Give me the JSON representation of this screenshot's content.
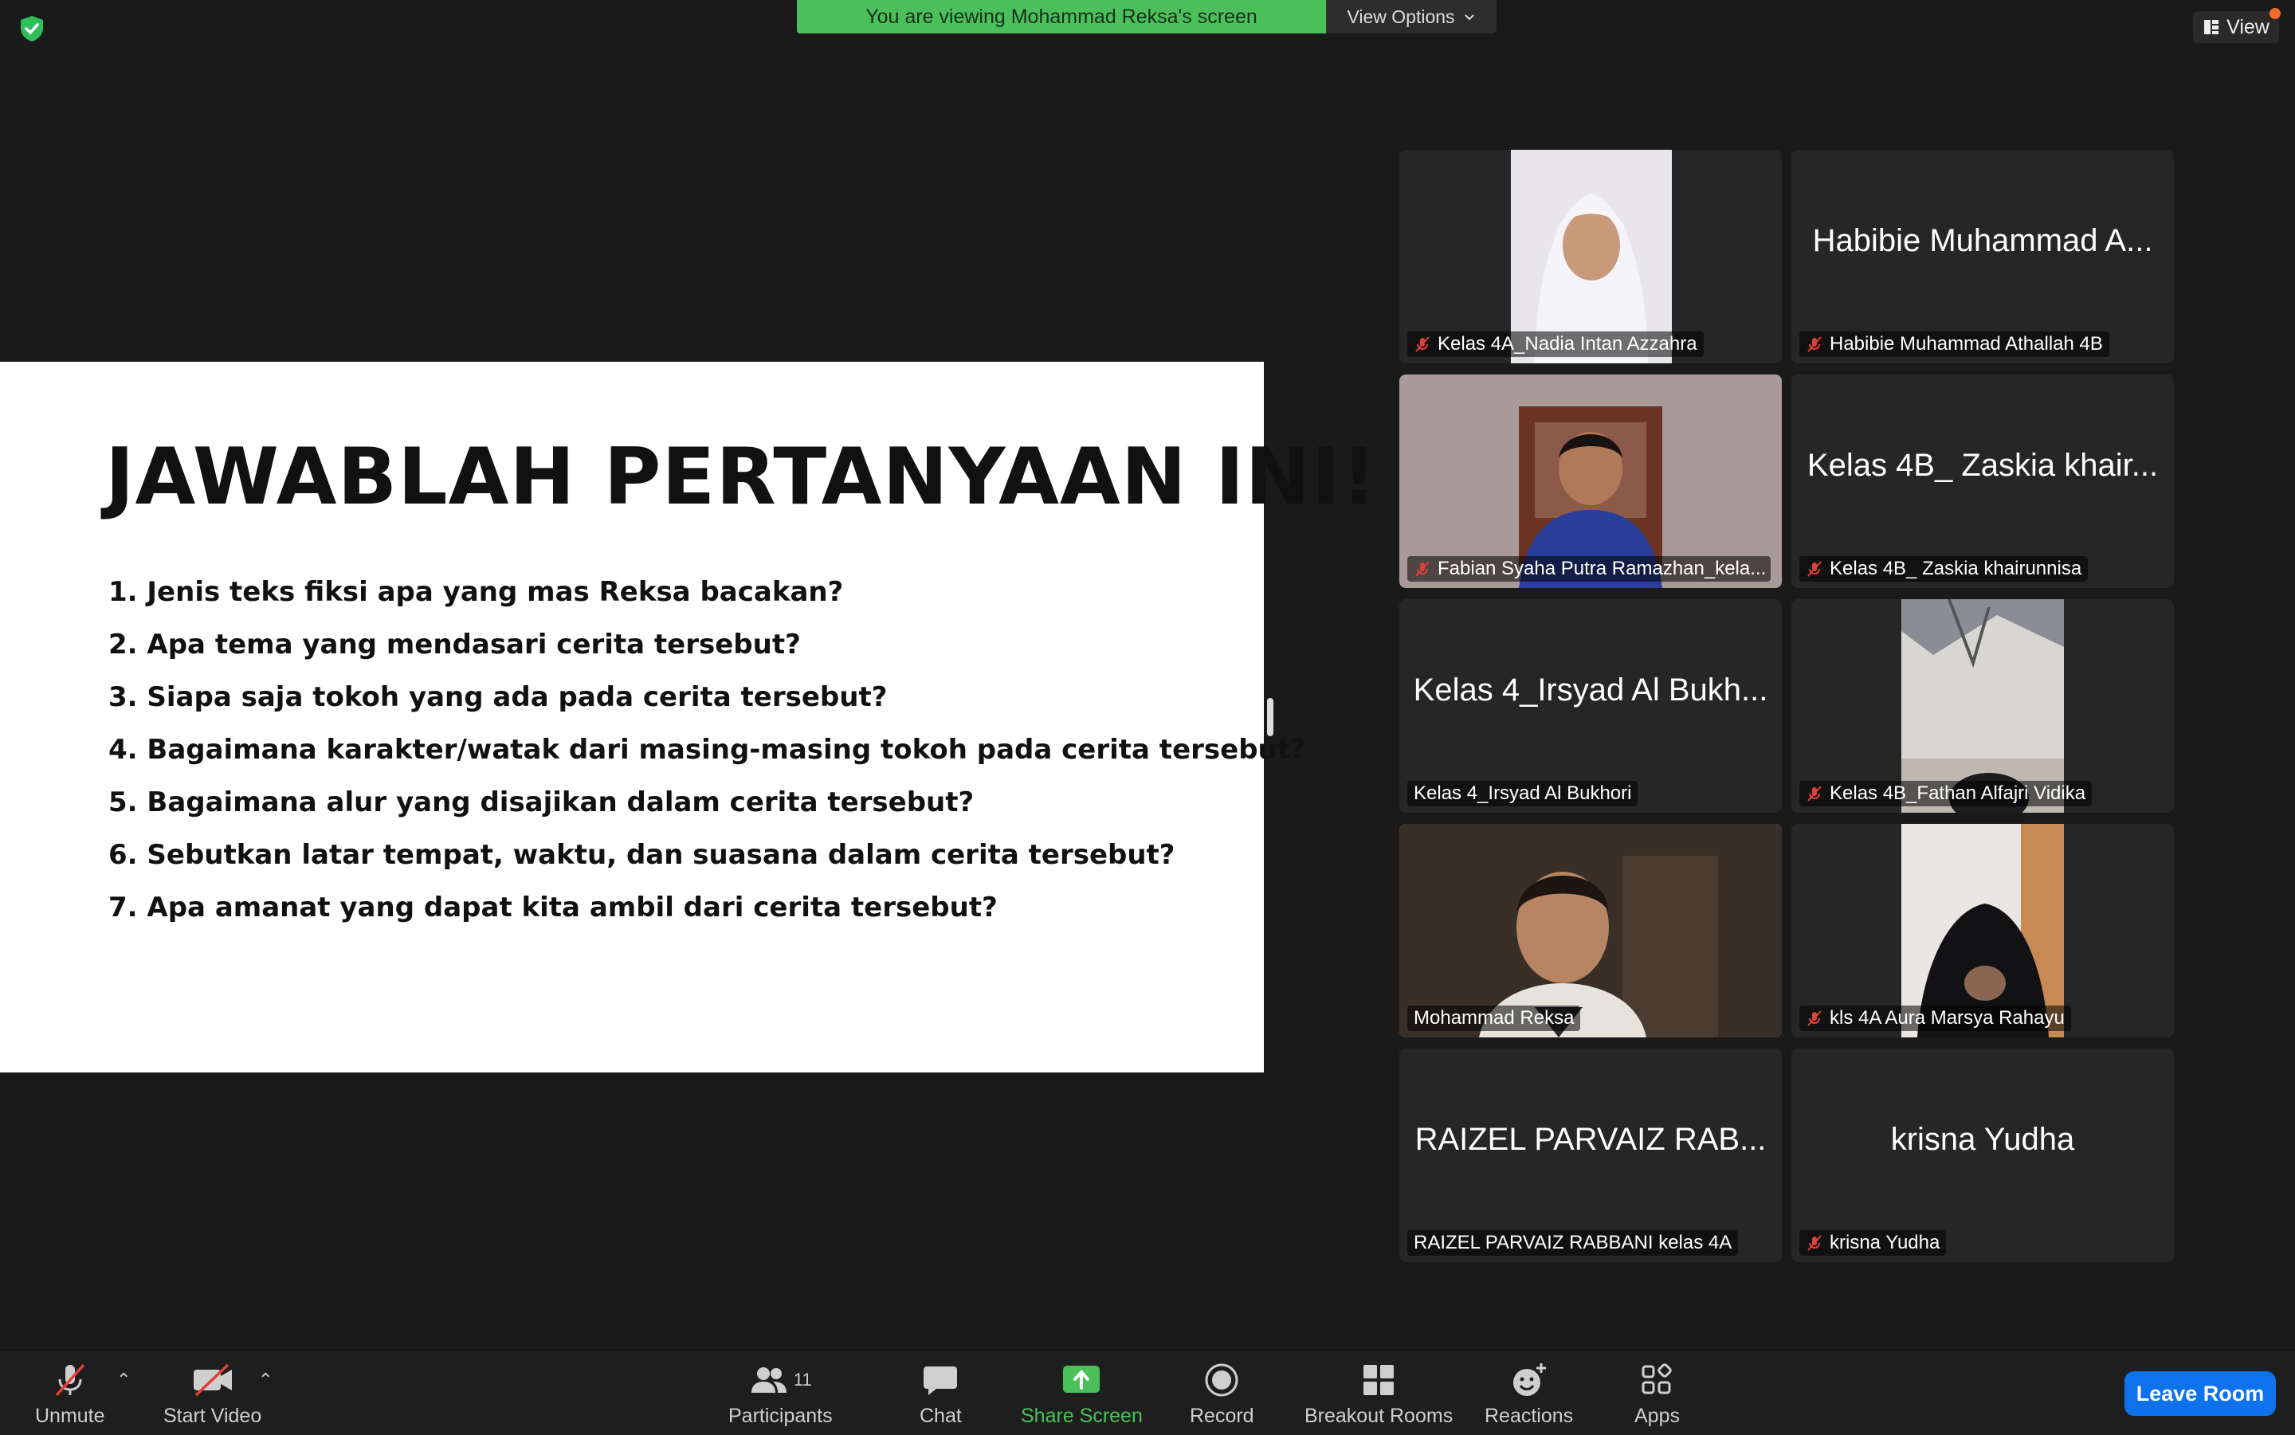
{
  "banner": {
    "message": "You are viewing Mohammad Reksa's screen",
    "view_options": "View Options"
  },
  "top_right": {
    "view_label": "View"
  },
  "slide": {
    "title": "JAWABLAH PERTANYAAN INI!",
    "questions": [
      "1. Jenis teks fiksi apa yang mas Reksa bacakan?",
      "2. Apa tema yang mendasari cerita tersebut?",
      "3. Siapa saja tokoh yang ada pada cerita tersebut?",
      "4. Bagaimana karakter/watak dari masing-masing tokoh pada cerita tersebut?",
      "5. Bagaimana alur yang disajikan dalam cerita tersebut?",
      "6. Sebutkan latar tempat, waktu, dan suasana dalam cerita tersebut?",
      "7. Apa amanat yang dapat kita ambil dari cerita tersebut?"
    ]
  },
  "participants": [
    {
      "label": "Kelas 4A_Nadia Intan Azzahra",
      "big_name": "",
      "muted": true,
      "video": "girl-hijab-white",
      "active": false
    },
    {
      "label": "Habibie Muhammad Athallah 4B",
      "big_name": "Habibie Muhammad A...",
      "muted": true,
      "video": "",
      "active": false
    },
    {
      "label": "Fabian Syaha Putra Ramazhan_kela...",
      "big_name": "",
      "muted": true,
      "video": "boy-chair",
      "active": false
    },
    {
      "label": "Kelas 4B_ Zaskia khairunnisa",
      "big_name": "Kelas 4B_ Zaskia khair...",
      "muted": true,
      "video": "",
      "active": false
    },
    {
      "label": "Kelas 4_Irsyad Al Bukhori",
      "big_name": "Kelas 4_Irsyad Al Bukh...",
      "muted": false,
      "video": "",
      "active": false
    },
    {
      "label": "Kelas 4B_Fathan Alfajri Vidika",
      "big_name": "",
      "muted": true,
      "video": "ceiling-face",
      "active": false
    },
    {
      "label": "Mohammad Reksa",
      "big_name": "",
      "muted": false,
      "video": "man-speaking",
      "active": true
    },
    {
      "label": "kls 4A Aura Marsya Rahayu",
      "big_name": "",
      "muted": true,
      "video": "girl-hijab-black",
      "active": false
    },
    {
      "label": "RAIZEL PARVAIZ RABBANI kelas 4A",
      "big_name": "RAIZEL PARVAIZ RAB...",
      "muted": false,
      "video": "",
      "active": false
    },
    {
      "label": "krisna Yudha",
      "big_name": "krisna Yudha",
      "muted": true,
      "video": "",
      "active": false
    }
  ],
  "toolbar": {
    "unmute": "Unmute",
    "start_video": "Start Video",
    "participants": "Participants",
    "participants_count": "11",
    "chat": "Chat",
    "share_screen": "Share Screen",
    "record": "Record",
    "breakout_rooms": "Breakout Rooms",
    "reactions": "Reactions",
    "apps": "Apps",
    "leave_room": "Leave Room"
  },
  "colors": {
    "banner_green": "#4bc05a",
    "active_speaker_border": "#5cd65c",
    "share_screen_green": "#4bc05a",
    "leave_blue": "#0e72ed",
    "muted_red": "#e0403a"
  }
}
